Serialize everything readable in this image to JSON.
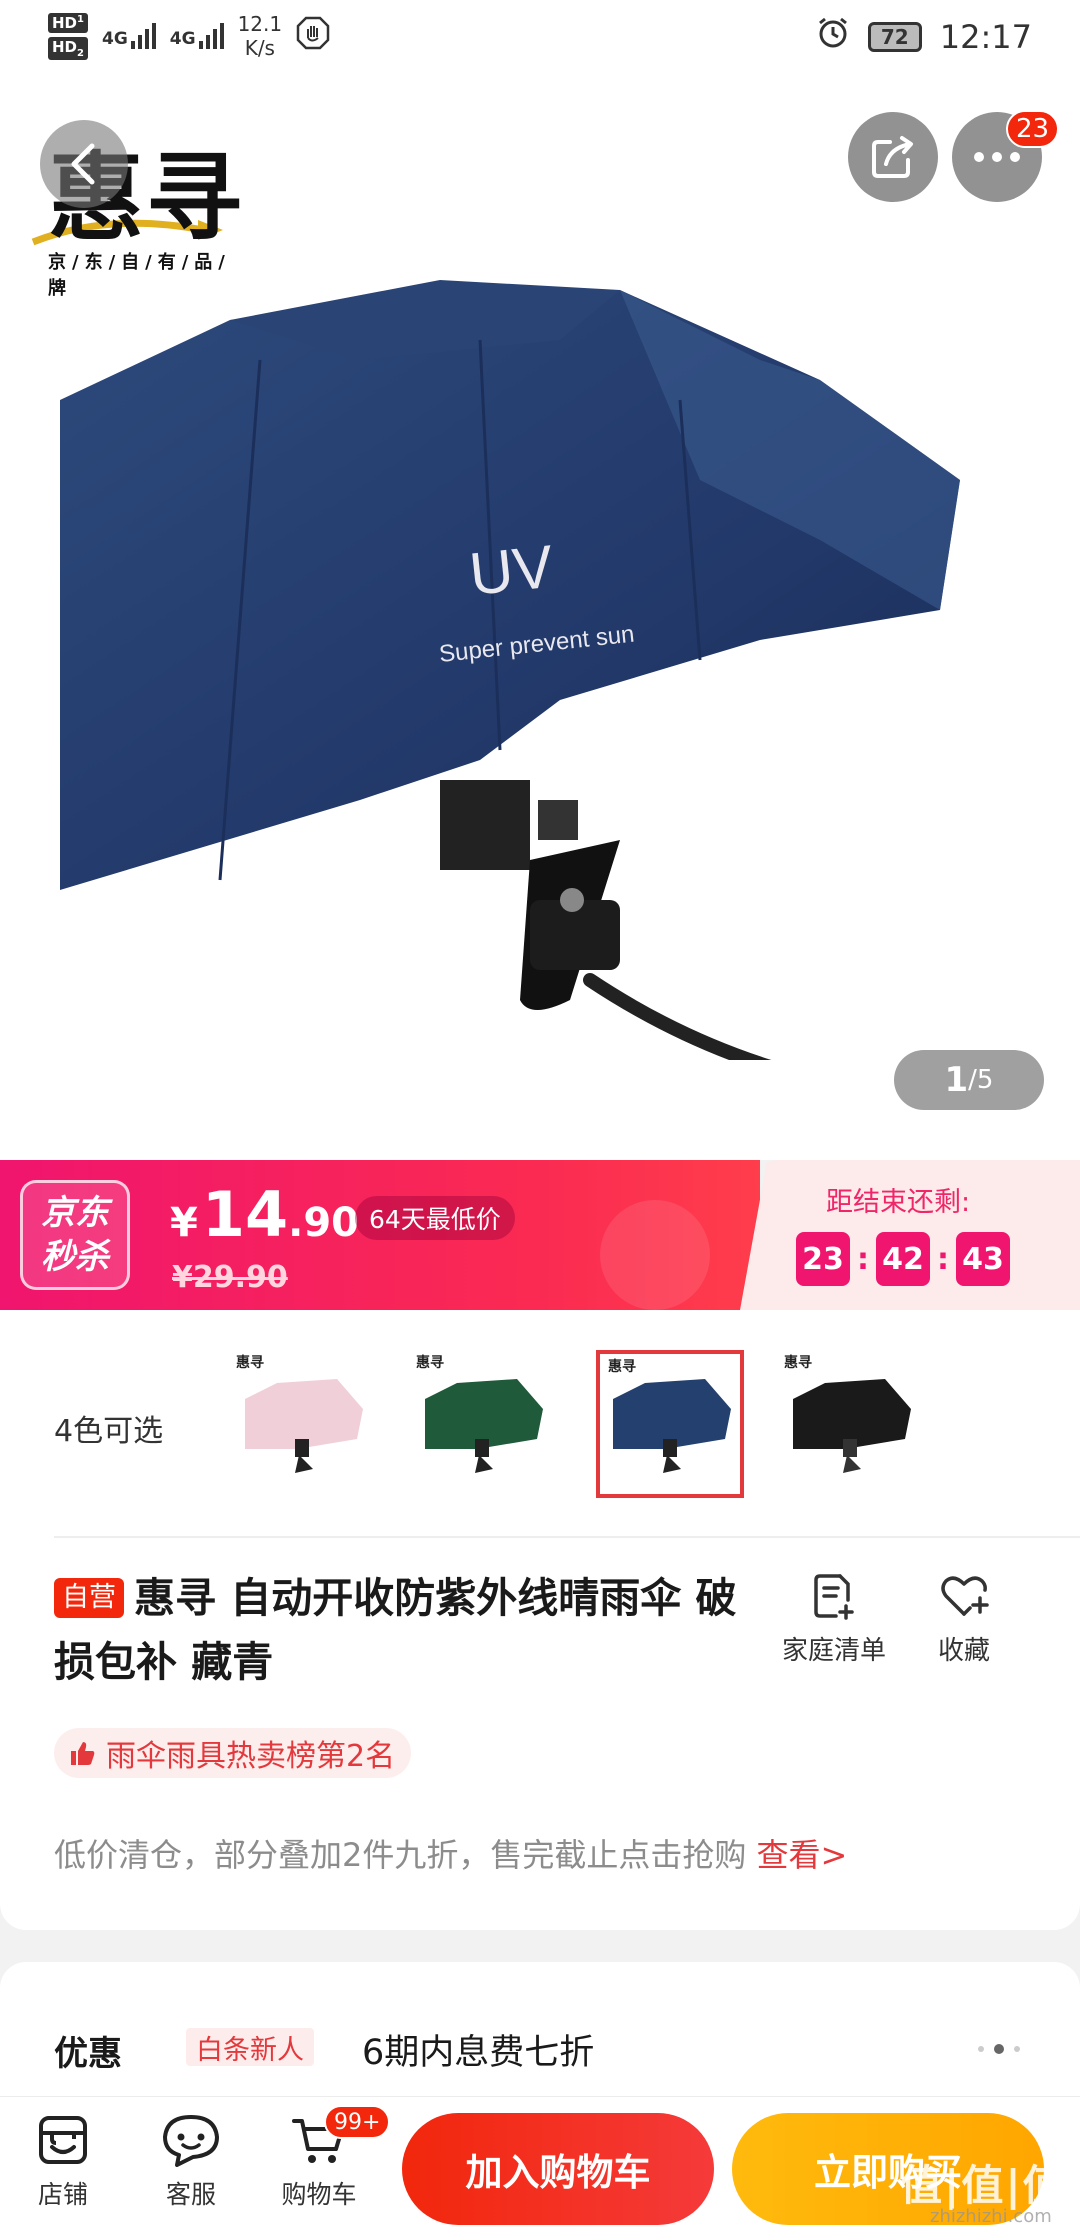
{
  "status_bar": {
    "hd1": "HD",
    "hd1_index": "1",
    "hd2": "HD",
    "hd2_index": "2",
    "net1": "4G",
    "net2": "4G",
    "speed_value": "12.1",
    "speed_unit": "K/s",
    "battery": "72",
    "time": "12:17",
    "icons": [
      "hand-icon",
      "alarm-icon",
      "battery-icon"
    ]
  },
  "header": {
    "brand_logo": "惠寻",
    "brand_sub": "京/东/自/有/品/牌",
    "more_badge": "23",
    "icons": [
      "back-arrow-icon",
      "share-icon",
      "more-icon"
    ]
  },
  "hero": {
    "image_text_main": "UV",
    "image_text_sub": "Super prevent sun",
    "pager_current": "1",
    "pager_total": "/5"
  },
  "sale": {
    "logo_line1": "京东",
    "logo_line2": "秒杀",
    "currency": "¥",
    "price_int": "14",
    "price_dec": ".90",
    "lowest_label": "64天最低价",
    "old_price": "¥29.90",
    "countdown_label": "距结束还剩:",
    "hours": "23",
    "minutes": "42",
    "seconds": "43",
    "colors": {
      "primary": "#f0156e",
      "panel": "#fdeaea"
    }
  },
  "colors_select": {
    "label": "4色可选",
    "swatches": [
      {
        "color": "#f0cfd8",
        "brand": "惠寻"
      },
      {
        "color": "#1f5a3a",
        "brand": "惠寻"
      },
      {
        "color": "#23406e",
        "brand": "惠寻",
        "selected": true
      },
      {
        "color": "#1a1a1a",
        "brand": "惠寻"
      }
    ]
  },
  "product": {
    "self_badge": "自营",
    "title": "惠寻 自动开收防紫外线晴雨伞 破损包补 藏青",
    "family_list": "家庭清单",
    "favorite": "收藏",
    "rank": "雨伞雨具热卖榜第2名",
    "promo": "低价清仓，部分叠加2件九折，售完截止点击抢购",
    "promo_link": "查看>"
  },
  "coupon": {
    "label": "优惠",
    "tag": "白条新人",
    "text": "6期内息费七折"
  },
  "bottom_bar": {
    "shop": "店铺",
    "service": "客服",
    "cart": "购物车",
    "cart_badge": "99+",
    "add_to_cart": "加入购物车",
    "buy_now": "立即购买",
    "accent": "#f2270c",
    "buy_color": "#ffa600"
  },
  "watermark": {
    "main": "值|值|值",
    "sub": "zhizhizhi.com"
  }
}
